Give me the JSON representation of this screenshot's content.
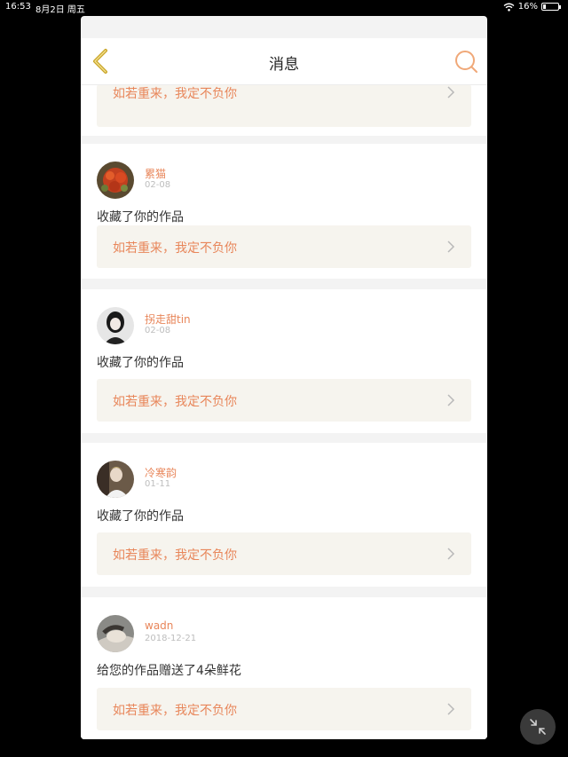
{
  "status_bar": {
    "time": "16:53",
    "date": "8月2日 周五",
    "battery": "16%",
    "battery_level": 0.16
  },
  "nav": {
    "title": "消息",
    "back_icon": "chevron-left-icon",
    "search_icon": "search-icon"
  },
  "partial_card": {
    "work_title": "如若重来，我定不负你"
  },
  "messages": [
    {
      "user": "累猫",
      "date": "02-08",
      "action": "收藏了你的作品",
      "work_title": "如若重来，我定不负你"
    },
    {
      "user": "拐走甜tin",
      "date": "02-08",
      "action": "收藏了你的作品",
      "work_title": "如若重来，我定不负你"
    },
    {
      "user": "冷寒韵",
      "date": "01-11",
      "action": "收藏了你的作品",
      "work_title": "如若重来，我定不负你"
    },
    {
      "user": "wadn",
      "date": "2018-12-21",
      "action": "给您的作品赠送了4朵鲜花",
      "work_title": "如若重来，我定不负你"
    }
  ],
  "colors": {
    "accent": "#e8865a",
    "back_arrow": "#c9a52a",
    "work_bg": "#f6f4ee"
  },
  "fab": {
    "icon": "minimize-icon"
  }
}
